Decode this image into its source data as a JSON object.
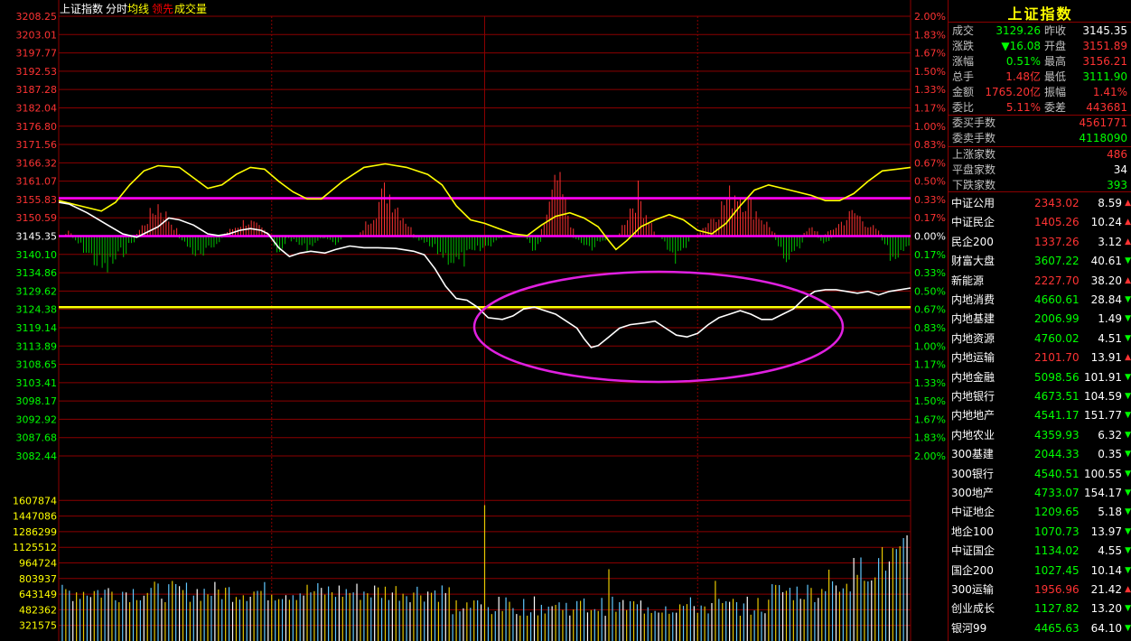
{
  "header": {
    "name": "上证指数",
    "mode": "分时",
    "legend": [
      {
        "label": "均线",
        "color": "#ffff00"
      },
      {
        "label": "领先",
        "color": "#ff0000"
      },
      {
        "label": "成交量",
        "color": "#ffff00"
      }
    ]
  },
  "chart_data": {
    "type": "line",
    "base_price": 3145.35,
    "price_ticks": [
      "3208.25",
      "3203.01",
      "3197.77",
      "3192.53",
      "3187.28",
      "3182.04",
      "3176.80",
      "3171.56",
      "3166.32",
      "3161.07",
      "3155.83",
      "3150.59",
      "3145.35",
      "3140.10",
      "3134.86",
      "3129.62",
      "3124.38",
      "3119.14",
      "3113.89",
      "3108.65",
      "3103.41",
      "3098.17",
      "3092.92",
      "3087.68",
      "3082.44"
    ],
    "pct_ticks": [
      "2.00%",
      "1.83%",
      "1.67%",
      "1.50%",
      "1.33%",
      "1.17%",
      "1.00%",
      "0.83%",
      "0.67%",
      "0.50%",
      "0.33%",
      "0.17%",
      "0.00%",
      "0.17%",
      "0.33%",
      "0.50%",
      "0.67%",
      "0.83%",
      "1.00%",
      "1.17%",
      "1.33%",
      "1.50%",
      "1.67%",
      "1.83%",
      "2.00%"
    ],
    "ylim": [
      3082.44,
      3208.25
    ],
    "volume_ticks": [
      "1607874",
      "1447086",
      "1286299",
      "1125512",
      "964724",
      "803937",
      "643149",
      "482362",
      "321575"
    ],
    "volume_ylim": [
      160787,
      1768661
    ],
    "horizontal_marks": [
      {
        "value": 3156.2,
        "color": "#ff00ff"
      },
      {
        "value": 3145.35,
        "color": "#ff00ff"
      },
      {
        "value": 3125.0,
        "color": "#ffff00"
      }
    ],
    "price_series": {
      "name": "上证指数",
      "color": "#ffffff",
      "points": [
        [
          0,
          3155.0
        ],
        [
          3,
          3154.5
        ],
        [
          8,
          3152.0
        ],
        [
          13,
          3149.0
        ],
        [
          18,
          3146.0
        ],
        [
          22,
          3145.0
        ],
        [
          25,
          3146.5
        ],
        [
          28,
          3148.0
        ],
        [
          31,
          3150.5
        ],
        [
          34,
          3150.0
        ],
        [
          38,
          3148.5
        ],
        [
          42,
          3146.0
        ],
        [
          45,
          3145.5
        ],
        [
          48,
          3146.0
        ],
        [
          51,
          3147.0
        ],
        [
          54,
          3147.5
        ],
        [
          57,
          3147.0
        ],
        [
          59,
          3146.0
        ],
        [
          62,
          3142.0
        ],
        [
          65,
          3139.5
        ],
        [
          68,
          3140.5
        ],
        [
          71,
          3141.0
        ],
        [
          75,
          3140.5
        ],
        [
          78,
          3141.5
        ],
        [
          82,
          3142.5
        ],
        [
          86,
          3142.0
        ],
        [
          90,
          3142.0
        ],
        [
          95,
          3141.8
        ],
        [
          100,
          3141.0
        ],
        [
          103,
          3140.0
        ],
        [
          106,
          3136.0
        ],
        [
          109,
          3131.0
        ],
        [
          112,
          3127.5
        ],
        [
          115,
          3127.0
        ],
        [
          118,
          3125.0
        ],
        [
          121,
          3122.0
        ],
        [
          125,
          3121.5
        ],
        [
          128,
          3122.5
        ],
        [
          131,
          3124.5
        ],
        [
          134,
          3125.0
        ],
        [
          137,
          3124.0
        ],
        [
          140,
          3123.0
        ],
        [
          143,
          3121.0
        ],
        [
          146,
          3119.0
        ],
        [
          148,
          3116.0
        ],
        [
          150,
          3113.5
        ],
        [
          152,
          3114.0
        ],
        [
          155,
          3116.5
        ],
        [
          158,
          3119.0
        ],
        [
          161,
          3120.0
        ],
        [
          165,
          3120.5
        ],
        [
          168,
          3121.0
        ],
        [
          171,
          3119.0
        ],
        [
          174,
          3117.0
        ],
        [
          177,
          3116.5
        ],
        [
          180,
          3117.5
        ],
        [
          183,
          3120.0
        ],
        [
          186,
          3122.0
        ],
        [
          189,
          3123.0
        ],
        [
          192,
          3124.0
        ],
        [
          195,
          3123.0
        ],
        [
          198,
          3121.5
        ],
        [
          201,
          3121.5
        ],
        [
          204,
          3123.0
        ],
        [
          207,
          3124.5
        ],
        [
          210,
          3127.5
        ],
        [
          213,
          3129.5
        ],
        [
          216,
          3130.0
        ],
        [
          219,
          3130.0
        ],
        [
          222,
          3129.5
        ],
        [
          225,
          3129.0
        ],
        [
          228,
          3129.5
        ],
        [
          231,
          3128.5
        ],
        [
          234,
          3129.5
        ],
        [
          237,
          3130.0
        ],
        [
          240,
          3130.5
        ]
      ]
    },
    "avg_series": {
      "name": "均线",
      "color": "#ffff00",
      "points": [
        [
          0,
          3155.5
        ],
        [
          6,
          3154.0
        ],
        [
          12,
          3152.5
        ],
        [
          16,
          3155.0
        ],
        [
          20,
          3160.0
        ],
        [
          24,
          3164.0
        ],
        [
          28,
          3165.5
        ],
        [
          34,
          3165.0
        ],
        [
          38,
          3162.0
        ],
        [
          42,
          3159.0
        ],
        [
          46,
          3160.0
        ],
        [
          50,
          3163.0
        ],
        [
          54,
          3165.0
        ],
        [
          58,
          3164.5
        ],
        [
          62,
          3161.0
        ],
        [
          66,
          3158.0
        ],
        [
          70,
          3156.0
        ],
        [
          74,
          3156.0
        ],
        [
          80,
          3161.0
        ],
        [
          86,
          3165.0
        ],
        [
          92,
          3166.0
        ],
        [
          98,
          3165.0
        ],
        [
          104,
          3163.0
        ],
        [
          108,
          3160.0
        ],
        [
          112,
          3154.0
        ],
        [
          116,
          3150.0
        ],
        [
          120,
          3149.0
        ],
        [
          124,
          3147.5
        ],
        [
          128,
          3146.0
        ],
        [
          132,
          3145.5
        ],
        [
          136,
          3148.5
        ],
        [
          140,
          3151.0
        ],
        [
          144,
          3152.0
        ],
        [
          148,
          3150.5
        ],
        [
          152,
          3148.0
        ],
        [
          155,
          3144.0
        ],
        [
          157,
          3141.5
        ],
        [
          160,
          3144.0
        ],
        [
          164,
          3148.0
        ],
        [
          168,
          3150.0
        ],
        [
          172,
          3151.5
        ],
        [
          176,
          3150.0
        ],
        [
          180,
          3147.0
        ],
        [
          184,
          3146.0
        ],
        [
          188,
          3149.0
        ],
        [
          192,
          3154.0
        ],
        [
          196,
          3158.5
        ],
        [
          200,
          3160.0
        ],
        [
          204,
          3159.0
        ],
        [
          208,
          3158.0
        ],
        [
          212,
          3157.0
        ],
        [
          216,
          3155.5
        ],
        [
          220,
          3155.5
        ],
        [
          224,
          3157.5
        ],
        [
          228,
          3161.0
        ],
        [
          232,
          3164.0
        ],
        [
          236,
          3164.5
        ],
        [
          240,
          3165.0
        ]
      ]
    }
  },
  "quote": {
    "rows": [
      {
        "l1": "成交",
        "v1": "3129.26",
        "c1": "#00ff00",
        "l2": "昨收",
        "v2": "3145.35",
        "c2": "#ffffff"
      },
      {
        "l1": "涨跌",
        "v1": "▼16.08",
        "c1": "#00ff00",
        "l2": "开盘",
        "v2": "3151.89",
        "c2": "#ff3333"
      },
      {
        "l1": "涨幅",
        "v1": "0.51%",
        "c1": "#00ff00",
        "l2": "最高",
        "v2": "3156.21",
        "c2": "#ff3333"
      },
      {
        "l1": "总手",
        "v1": "1.48亿",
        "c1": "#ff3333",
        "l2": "最低",
        "v2": "3111.90",
        "c2": "#00ff00"
      },
      {
        "l1": "金额",
        "v1": "1765.20亿",
        "c1": "#ff3333",
        "l2": "振幅",
        "v2": "1.41%",
        "c2": "#ff3333"
      },
      {
        "l1": "委比",
        "v1": "5.11%",
        "c1": "#ff3333",
        "l2": "委差",
        "v2": "443681",
        "c2": "#ff3333"
      }
    ],
    "single_rows": [
      {
        "label": "委买手数",
        "value": "4561771",
        "color": "#ff3333"
      },
      {
        "label": "委卖手数",
        "value": "4118090",
        "color": "#00ff00"
      },
      {
        "label": "上涨家数",
        "value": "486",
        "color": "#ff3333"
      },
      {
        "label": "平盘家数",
        "value": "34",
        "color": "#ffffff"
      },
      {
        "label": "下跌家数",
        "value": "393",
        "color": "#00ff00"
      }
    ]
  },
  "indices": [
    {
      "name": "中证公用",
      "value": "2343.02",
      "change": "8.59",
      "dir": "up"
    },
    {
      "name": "中证民企",
      "value": "1405.26",
      "change": "10.24",
      "dir": "up"
    },
    {
      "name": "民企200",
      "value": "1337.26",
      "change": "3.12",
      "dir": "up"
    },
    {
      "name": "财富大盘",
      "value": "3607.22",
      "change": "40.61",
      "dir": "down"
    },
    {
      "name": "新能源",
      "value": "2227.70",
      "change": "38.20",
      "dir": "up"
    },
    {
      "name": "内地消费",
      "value": "4660.61",
      "change": "28.84",
      "dir": "down"
    },
    {
      "name": "内地基建",
      "value": "2006.99",
      "change": "1.49",
      "dir": "down"
    },
    {
      "name": "内地资源",
      "value": "4760.02",
      "change": "4.51",
      "dir": "down"
    },
    {
      "name": "内地运输",
      "value": "2101.70",
      "change": "13.91",
      "dir": "up"
    },
    {
      "name": "内地金融",
      "value": "5098.56",
      "change": "101.91",
      "dir": "down"
    },
    {
      "name": "内地银行",
      "value": "4673.51",
      "change": "104.59",
      "dir": "down"
    },
    {
      "name": "内地地产",
      "value": "4541.17",
      "change": "151.77",
      "dir": "down"
    },
    {
      "name": "内地农业",
      "value": "4359.93",
      "change": "6.32",
      "dir": "down"
    },
    {
      "name": "300基建",
      "value": "2044.33",
      "change": "0.35",
      "dir": "down"
    },
    {
      "name": "300银行",
      "value": "4540.51",
      "change": "100.55",
      "dir": "down"
    },
    {
      "name": "300地产",
      "value": "4733.07",
      "change": "154.17",
      "dir": "down"
    },
    {
      "name": "中证地企",
      "value": "1209.65",
      "change": "5.18",
      "dir": "down"
    },
    {
      "name": "地企100",
      "value": "1070.73",
      "change": "13.97",
      "dir": "down"
    },
    {
      "name": "中证国企",
      "value": "1134.02",
      "change": "4.55",
      "dir": "down"
    },
    {
      "name": "国企200",
      "value": "1027.45",
      "change": "10.14",
      "dir": "down"
    },
    {
      "name": "300运输",
      "value": "1956.96",
      "change": "21.42",
      "dir": "up"
    },
    {
      "name": "创业成长",
      "value": "1127.82",
      "change": "13.20",
      "dir": "down"
    },
    {
      "name": "银河99",
      "value": "4465.63",
      "change": "64.10",
      "dir": "down"
    }
  ],
  "colors": {
    "up": "#ff3333",
    "down": "#00ff00",
    "grid": "#8b0000",
    "accent_magenta": "#ff00ff",
    "accent_yellow": "#ffff00"
  }
}
